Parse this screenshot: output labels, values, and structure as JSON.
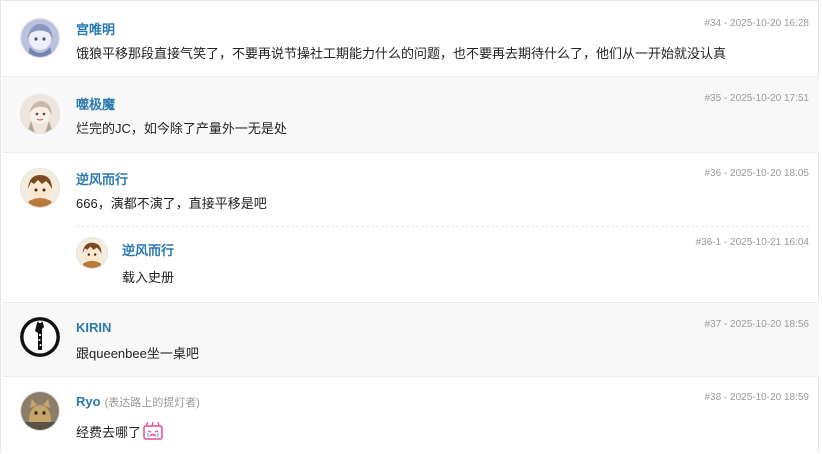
{
  "posts": [
    {
      "user": "宫唯明",
      "meta": "#34 - 2025-10-20 16:28",
      "content": "饿狼平移那段直接气笑了，不要再说节操社工期能力什么的问题，也不要再去期待什么了，他们从一开始就没认真",
      "avatar_icon": "anime-girl-avatar"
    },
    {
      "user": "噬极魔",
      "meta": "#35 - 2025-10-20 17:51",
      "content": "烂完的JC，如今除了产量外一无是处",
      "avatar_icon": "anime-character-avatar"
    },
    {
      "user": "逆风而行",
      "meta": "#36 - 2025-10-20 18:05",
      "content": "666，演都不演了，直接平移是吧",
      "avatar_icon": "brown-hair-boy-avatar",
      "reply": {
        "user": "逆风而行",
        "meta": "#36-1 - 2025-10-21 16:04",
        "content": "载入史册"
      }
    },
    {
      "user": "KIRIN",
      "meta": "#37 - 2025-10-20 18:56",
      "content": "跟queenbee坐一桌吧",
      "avatar_icon": "giraffe-logo-avatar"
    },
    {
      "user": "Ryo",
      "title": "(表达路上的提灯者)",
      "meta": "#38 - 2025-10-20 18:59",
      "content": "经费去哪了",
      "emoticon": "pink-crying-emoticon",
      "avatar_icon": "cat-avatar"
    }
  ]
}
